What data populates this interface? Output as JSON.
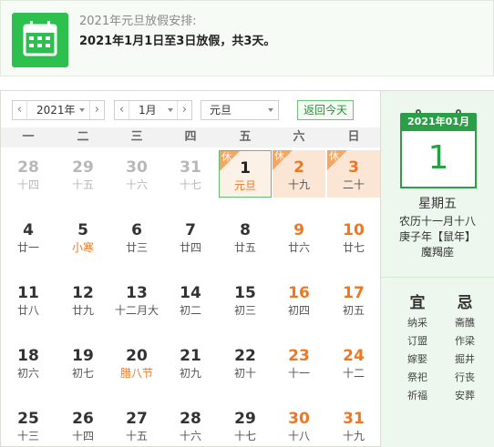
{
  "notice": {
    "title": "2021年元旦放假安排:",
    "detail": "2021年1月1日至3日放假，共3天。",
    "icon": "calendar-icon",
    "accent": "#2dc04e"
  },
  "toolbar": {
    "year_value": "2021年",
    "month_value": "1月",
    "holiday_value": "元旦",
    "today_button": "返回今天",
    "prev_symbol": "‹",
    "next_symbol": "›"
  },
  "weekdays": [
    "一",
    "二",
    "三",
    "四",
    "五",
    "六",
    "日"
  ],
  "badge_text": "休",
  "days": [
    {
      "num": "28",
      "lunar": "十四",
      "type": "other"
    },
    {
      "num": "29",
      "lunar": "十五",
      "type": "other"
    },
    {
      "num": "30",
      "lunar": "十六",
      "type": "other"
    },
    {
      "num": "31",
      "lunar": "十七",
      "type": "other"
    },
    {
      "num": "1",
      "lunar": "元旦",
      "type": "today",
      "rest": true,
      "festival": true
    },
    {
      "num": "2",
      "lunar": "十九",
      "type": "weekend",
      "rest": true
    },
    {
      "num": "3",
      "lunar": "二十",
      "type": "weekend",
      "rest": true
    },
    {
      "num": "4",
      "lunar": "廿一",
      "type": "normal"
    },
    {
      "num": "5",
      "lunar": "小寒",
      "type": "normal",
      "festival": true
    },
    {
      "num": "6",
      "lunar": "廿三",
      "type": "normal"
    },
    {
      "num": "7",
      "lunar": "廿四",
      "type": "normal"
    },
    {
      "num": "8",
      "lunar": "廿五",
      "type": "normal"
    },
    {
      "num": "9",
      "lunar": "廿六",
      "type": "weekend"
    },
    {
      "num": "10",
      "lunar": "廿七",
      "type": "weekend"
    },
    {
      "num": "11",
      "lunar": "廿八",
      "type": "normal"
    },
    {
      "num": "12",
      "lunar": "廿九",
      "type": "normal"
    },
    {
      "num": "13",
      "lunar": "十二月大",
      "type": "normal"
    },
    {
      "num": "14",
      "lunar": "初二",
      "type": "normal"
    },
    {
      "num": "15",
      "lunar": "初三",
      "type": "normal"
    },
    {
      "num": "16",
      "lunar": "初四",
      "type": "weekend"
    },
    {
      "num": "17",
      "lunar": "初五",
      "type": "weekend"
    },
    {
      "num": "18",
      "lunar": "初六",
      "type": "normal"
    },
    {
      "num": "19",
      "lunar": "初七",
      "type": "normal"
    },
    {
      "num": "20",
      "lunar": "腊八节",
      "type": "normal",
      "festival": true
    },
    {
      "num": "21",
      "lunar": "初九",
      "type": "normal"
    },
    {
      "num": "22",
      "lunar": "初十",
      "type": "normal"
    },
    {
      "num": "23",
      "lunar": "十一",
      "type": "weekend"
    },
    {
      "num": "24",
      "lunar": "十二",
      "type": "weekend"
    },
    {
      "num": "25",
      "lunar": "十三",
      "type": "normal"
    },
    {
      "num": "26",
      "lunar": "十四",
      "type": "normal"
    },
    {
      "num": "27",
      "lunar": "十五",
      "type": "normal"
    },
    {
      "num": "28",
      "lunar": "十六",
      "type": "normal"
    },
    {
      "num": "29",
      "lunar": "十七",
      "type": "normal"
    },
    {
      "num": "30",
      "lunar": "十八",
      "type": "weekend"
    },
    {
      "num": "31",
      "lunar": "十九",
      "type": "weekend"
    }
  ],
  "panel": {
    "header": "2021年01月",
    "day": "1",
    "weekday": "星期五",
    "lunar": "农历十一月十八",
    "ganzhi": "庚子年【鼠年】",
    "star": "魔羯座",
    "yi_title": "宜",
    "ji_title": "忌",
    "yi": [
      "纳采",
      "订盟",
      "嫁娶",
      "祭祀",
      "祈福"
    ],
    "ji": [
      "斋醮",
      "作梁",
      "掘井",
      "行丧",
      "安葬"
    ]
  },
  "colors": {
    "green": "#2b9f47",
    "orange": "#f0771f",
    "rest_bg": "#fbe6d6",
    "badge": "#f2a765"
  }
}
